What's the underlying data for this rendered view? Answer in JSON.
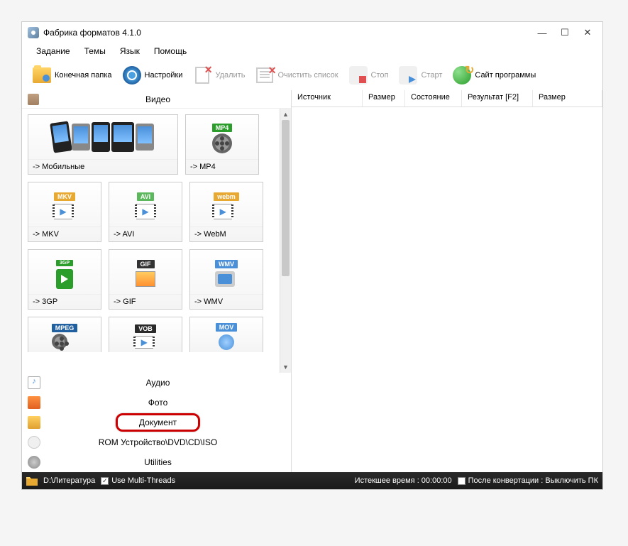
{
  "title": "Фабрика форматов 4.1.0",
  "menu": {
    "task": "Задание",
    "themes": "Темы",
    "language": "Язык",
    "help": "Помощь"
  },
  "toolbar": {
    "output_folder": "Конечная папка",
    "settings": "Настройки",
    "delete": "Удалить",
    "clear_list": "Очистить список",
    "stop": "Стоп",
    "start": "Старт",
    "site": "Сайт программы"
  },
  "categories": {
    "video": "Видео",
    "audio": "Аудио",
    "photo": "Фото",
    "document": "Документ",
    "rom": "ROM Устройство\\DVD\\CD\\ISO",
    "utilities": "Utilities"
  },
  "formats": {
    "mobile": "-> Мобильные",
    "mp4": "-> MP4",
    "mkv": "-> MKV",
    "avi": "-> AVI",
    "webm": "-> WebM",
    "gp3": "-> 3GP",
    "gif": "-> GIF",
    "wmv": "-> WMV"
  },
  "badges": {
    "mp4": "MP4",
    "mkv": "MKV",
    "avi": "AVI",
    "webm": "webm",
    "gp3": "3GP",
    "gif": "GIF",
    "wmv": "WMV",
    "mpeg": "MPEG",
    "vob": "VOB",
    "mov": "MOV"
  },
  "columns": {
    "source": "Источник",
    "size": "Размер",
    "state": "Состояние",
    "result": "Результат [F2]",
    "size2": "Размер"
  },
  "status": {
    "path": "D:\\Литература",
    "multithreads": "Use Multi-Threads",
    "elapsed": "Истекшее время : 00:00:00",
    "after": "После конвертации : Выключить ПК"
  }
}
